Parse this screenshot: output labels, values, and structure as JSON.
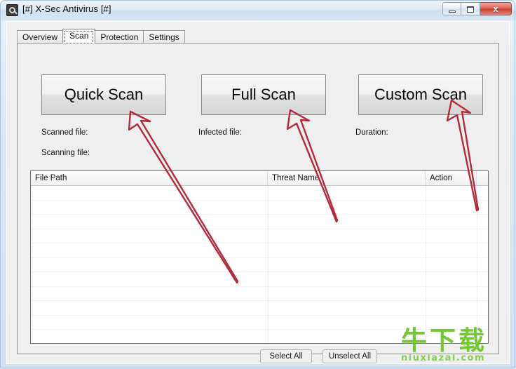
{
  "window": {
    "title": "[#] X-Sec Antivirus [#]",
    "icon": "app-shield-icon",
    "controls": {
      "minimize": "minimize-icon",
      "maximize": "maximize-icon",
      "close": "x"
    }
  },
  "tabs": [
    {
      "label": "Overview",
      "active": false
    },
    {
      "label": "Scan",
      "active": true
    },
    {
      "label": "Protection",
      "active": false
    },
    {
      "label": "Settings",
      "active": false
    }
  ],
  "scan_buttons": {
    "quick": "Quick Scan",
    "full": "Full Scan",
    "custom": "Custom Scan"
  },
  "status": {
    "scanned_file": "Scanned file:",
    "scanned_file_value": "",
    "scanning_file": "Scanning file:",
    "scanning_file_value": "",
    "infected_file": "Infected file:",
    "infected_file_value": "",
    "duration": "Duration:",
    "duration_value": ""
  },
  "results_table": {
    "columns": [
      "File Path",
      "Threat Name",
      "Action",
      ""
    ],
    "rows": []
  },
  "footer": {
    "select_all": "Select All",
    "unselect_all": "Unselect All"
  },
  "annotations": {
    "arrow_color": "#b5293a",
    "arrows": [
      {
        "name": "arrow-to-quick-scan",
        "points_at": "Quick Scan"
      },
      {
        "name": "arrow-to-full-scan",
        "points_at": "Full Scan"
      },
      {
        "name": "arrow-to-custom-scan",
        "points_at": "Custom Scan"
      }
    ]
  },
  "watermark": {
    "chinese": "牛下载",
    "url": "niuxiazai.com",
    "color": "#74c832"
  }
}
